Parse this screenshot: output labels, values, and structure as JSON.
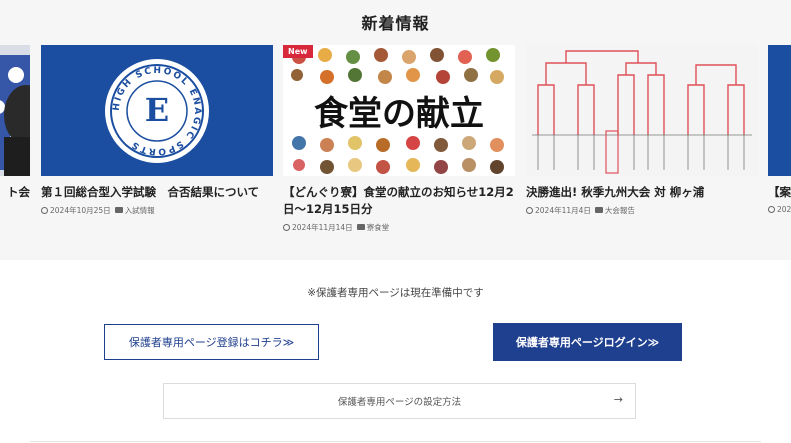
{
  "section": {
    "title": "新着情報"
  },
  "cards": [
    {
      "title_tail": "ト会"
    },
    {
      "title": "第１回総合型入学試験　合否結果について",
      "date": "2024年10月25日",
      "category": "入試情報",
      "logo": {
        "letter": "E",
        "ring_text": "HIGH SCHOOL ENAGIC SPORTS"
      }
    },
    {
      "badge": "New",
      "title": "【どんぐり寮】食堂の献立のお知らせ12月2日〜12月15日分",
      "date": "2024年11月14日",
      "category": "寮食堂",
      "image_text": "食堂の献立"
    },
    {
      "title": "決勝進出! 秋季九州大会 対 柳ヶ浦",
      "date": "2024年11月4日",
      "category": "大会報告"
    },
    {
      "title_head": "【案",
      "date_head": "202"
    }
  ],
  "notice": "※保護者専用ページは現在準備中です",
  "buttons": {
    "register": "保護者専用ページ登録はコチラ≫",
    "login": "保護者専用ページログイン≫"
  },
  "howto": {
    "label": "保護者専用ページの設定方法",
    "arrow": "→"
  },
  "colors": {
    "brand_blue": "#1f3f8f",
    "logo_blue": "#1b4ea0",
    "badge_red": "#d8283b",
    "bracket_red": "#e0505a"
  }
}
